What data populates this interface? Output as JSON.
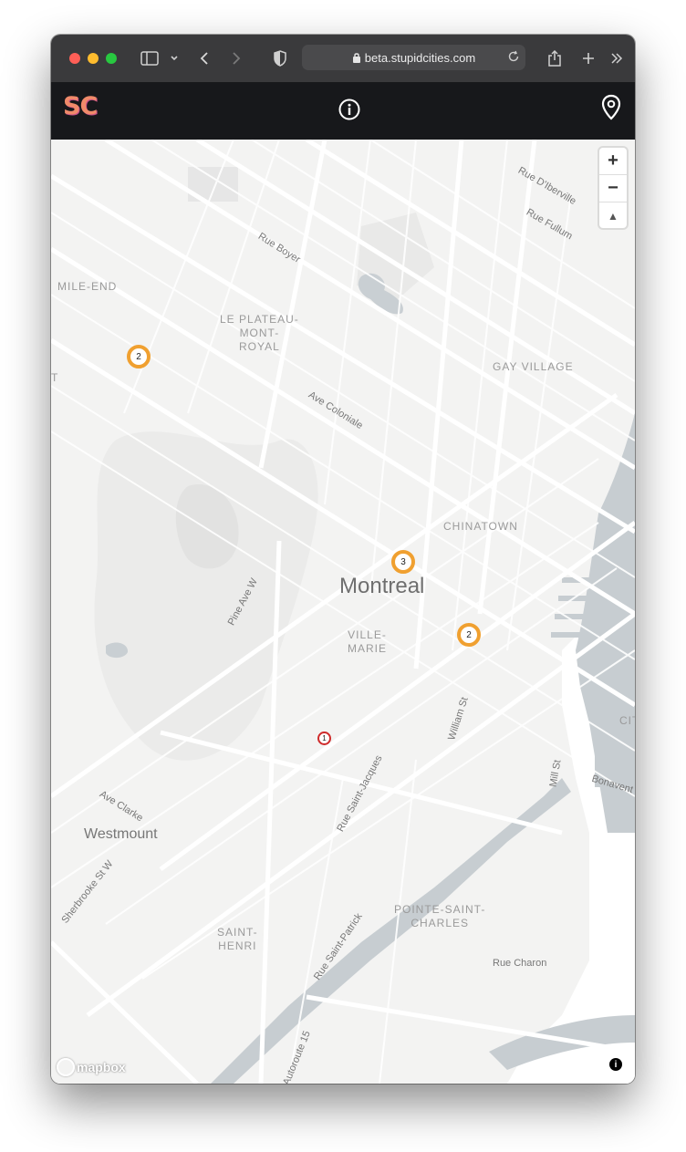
{
  "browser": {
    "url": "beta.stupidcities.com"
  },
  "app": {
    "logo_text": "SC"
  },
  "map": {
    "labels": {
      "mile_end": "MILE-END",
      "plateau": "LE PLATEAU-\nMONT-\nROYAL",
      "gay_village": "GAY VILLAGE",
      "chinatown": "CHINATOWN",
      "montreal": "Montreal",
      "ville_marie": "VILLE-\nMARIE",
      "westmount": "Westmount",
      "saint_henri": "SAINT-\nHENRI",
      "pointe_saint_charles": "POINTE-SAINT-\nCHARLES",
      "rue_boyer": "Rue Boyer",
      "ave_coloniale": "Ave Coloniale",
      "rue_diberville": "Rue D'Iberville",
      "rue_fullum": "Rue Fullum",
      "pine_ave_w": "Pine Ave W",
      "william_st": "William St",
      "rue_saint_jacques": "Rue Saint-Jacques",
      "mill_st": "Mill St",
      "bonaventure": "Bonavent",
      "ave_clarke": "Ave Clarke",
      "sherbrooke_st_w": "Sherbrooke St W",
      "rue_charon": "Rue Charon",
      "rue_saint_patrick": "Rue Saint-Patrick",
      "autoroute_15": "Autoroute 15",
      "cite": "CIT",
      "edge_t": "T"
    },
    "markers": [
      {
        "count": "2",
        "color": "orange"
      },
      {
        "count": "3",
        "color": "orange"
      },
      {
        "count": "2",
        "color": "orange"
      },
      {
        "count": "1",
        "color": "red"
      }
    ],
    "zoom_in": "+",
    "zoom_out": "−",
    "compass": "▲",
    "attribution": "mapbox",
    "info": "i"
  },
  "colors": {
    "marker_orange": "#f0a030",
    "marker_red": "#cf2b2b",
    "header_bg": "#17181b"
  }
}
